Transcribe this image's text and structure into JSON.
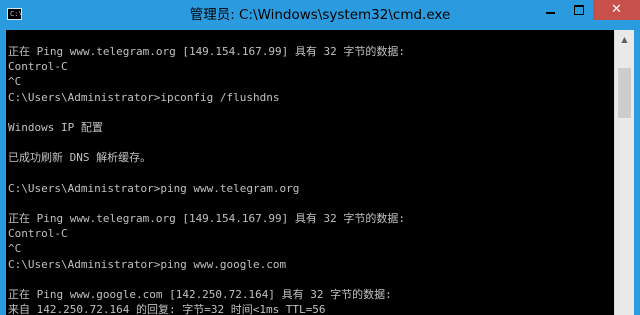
{
  "window": {
    "title": "管理员: C:\\Windows\\system32\\cmd.exe",
    "icon_prompt": "C:\\",
    "controls": {
      "minimize_icon": "minimize-icon",
      "maximize_icon": "maximize-icon",
      "close_label": "✕"
    },
    "frame_color": "#2b9be0",
    "close_color": "#c7504b"
  },
  "console": {
    "background": "#000000",
    "foreground": "#c0c0c0",
    "lines": [
      "正在 Ping www.telegram.org [149.154.167.99] 具有 32 字节的数据:",
      "Control-C",
      "^C",
      "C:\\Users\\Administrator>ipconfig /flushdns",
      "",
      "Windows IP 配置",
      "",
      "已成功刷新 DNS 解析缓存。",
      "",
      "C:\\Users\\Administrator>ping www.telegram.org",
      "",
      "正在 Ping www.telegram.org [149.154.167.99] 具有 32 字节的数据:",
      "Control-C",
      "^C",
      "C:\\Users\\Administrator>ping www.google.com",
      "",
      "正在 Ping www.google.com [142.250.72.164] 具有 32 字节的数据:",
      "来自 142.250.72.164 的回复: 字节=32 时间<1ms TTL=56"
    ]
  },
  "scrollbar": {
    "up_arrow": "▲"
  }
}
